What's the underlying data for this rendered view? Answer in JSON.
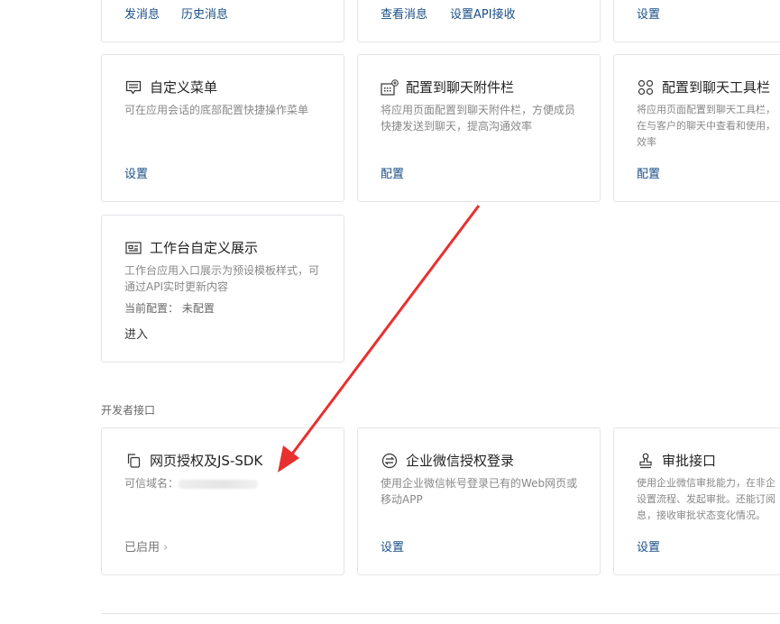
{
  "top_row": [
    {
      "links": [
        "发消息",
        "历史消息"
      ]
    },
    {
      "links": [
        "查看消息",
        "设置API接收"
      ]
    },
    {
      "links": [
        "设置"
      ]
    }
  ],
  "cards": [
    {
      "icon": "menu-comment-icon",
      "title": "自定义菜单",
      "desc": "可在应用会话的底部配置快捷操作菜单",
      "link": "设置"
    },
    {
      "icon": "attachment-bar-icon",
      "title": "配置到聊天附件栏",
      "desc": "将应用页面配置到聊天附件栏，方便成员\n快捷发送到聊天，提高沟通效率",
      "link": "配置"
    },
    {
      "icon": "toolbar-icon",
      "title": "配置到聊天工具栏",
      "desc": "将应用页面配置到聊天工具栏，\n在与客户的聊天中查看和使用，\n效率",
      "link": "配置"
    },
    {
      "icon": "workbench-icon",
      "title": "工作台自定义展示",
      "desc": "工作台应用入口展示为预设模板样式，可\n通过API实时更新内容",
      "current_label": "当前配置：",
      "current_value": "未配置",
      "link": "进入"
    }
  ],
  "dev_section": {
    "heading": "开发者接口",
    "cards": [
      {
        "icon": "web-auth-icon",
        "title": "网页授权及JS-SDK",
        "domain_label": "可信域名：",
        "link": "已启用"
      },
      {
        "icon": "login-icon",
        "title": "企业微信授权登录",
        "desc": "使用企业微信帐号登录已有的Web网页或\n移动APP",
        "link": "设置"
      },
      {
        "icon": "approval-stamp-icon",
        "title": "审批接口",
        "desc": "使用企业微信审批能力，在非企\n设置流程、发起审批。还能订阅\n息，接收审批状态变化情况。",
        "link": "设置"
      }
    ]
  },
  "annotation": {
    "arrow_color": "#e8302f"
  },
  "colors": {
    "link": "#1b4f86",
    "border": "#e2e4e8"
  }
}
